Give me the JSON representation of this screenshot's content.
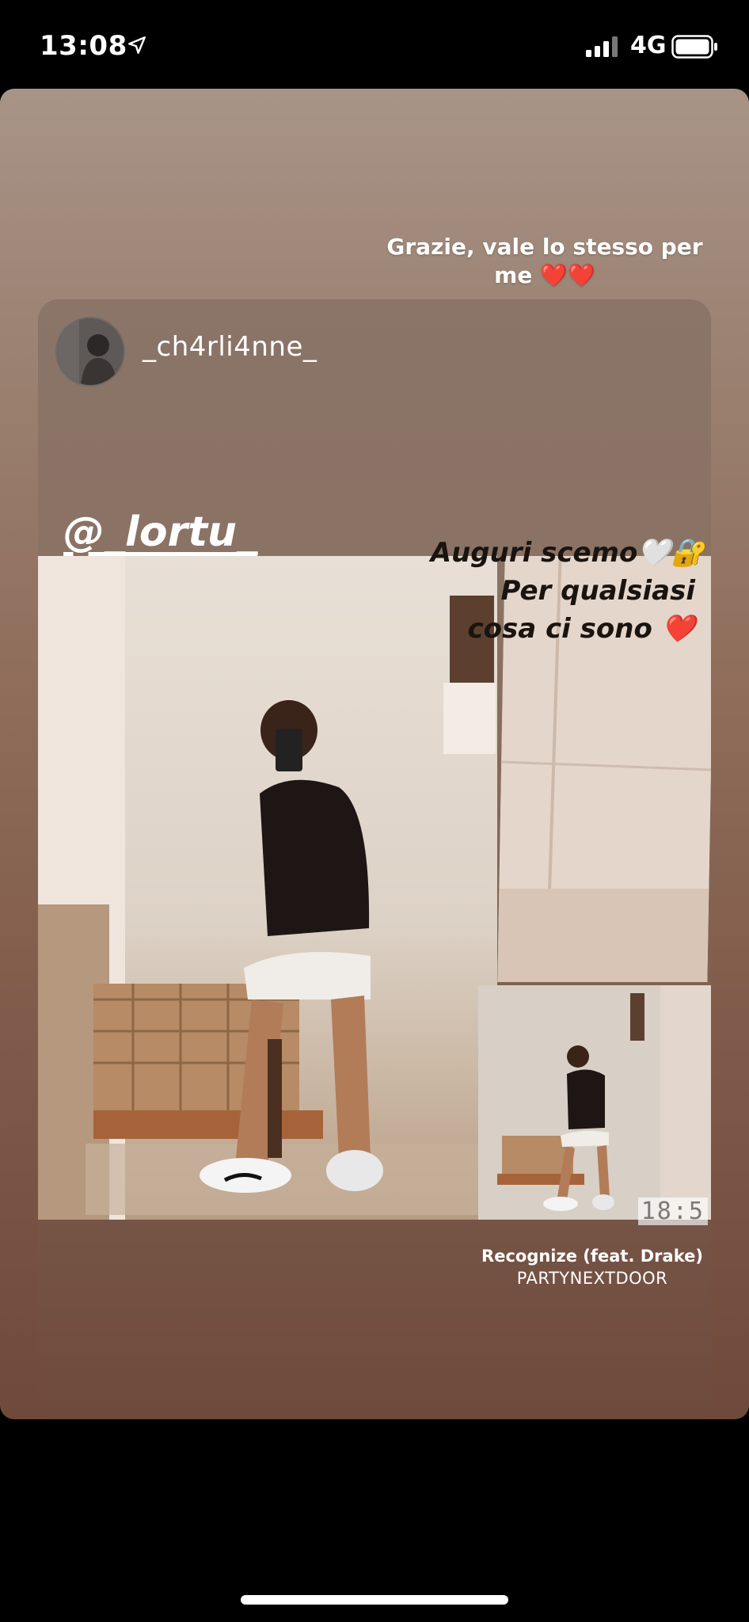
{
  "status_bar": {
    "time": "13:08",
    "location_icon": "location-arrow-icon",
    "signal_icon": "cellular-signal-icon",
    "network": "4G",
    "battery_icon": "battery-icon"
  },
  "story": {
    "caption": "Grazie, vale lo stesso per me ❤️❤️"
  },
  "repost": {
    "username": "_ch4rli4nne_",
    "mention": "@_lortu_",
    "overlay_lines": [
      "Auguri scemo🤍🔐",
      "Per qualsiasi",
      "cosa ci sono ❤️"
    ],
    "timestamp": "18:5",
    "music": {
      "song": "Recognize (feat. Drake)",
      "artist": "PARTYNEXTDOOR"
    }
  },
  "colors": {
    "background": "#000000",
    "story_top": "#a89487",
    "story_bottom": "#6f4a3a",
    "text": "#ffffff"
  }
}
